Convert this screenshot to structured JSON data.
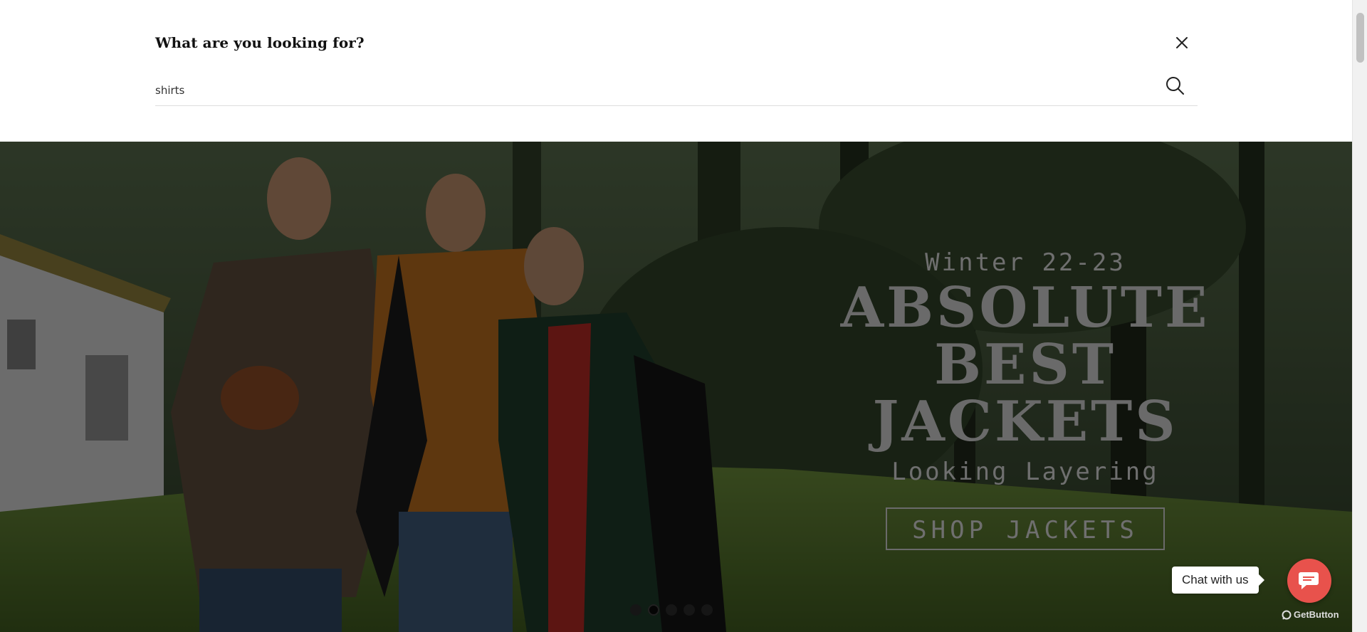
{
  "search": {
    "title": "What are you looking for?",
    "value": "shirts",
    "close_icon": "close-icon",
    "submit_icon": "search-icon"
  },
  "hero": {
    "season": "Winter 22-23",
    "headline_line1": "ABSOLUTE",
    "headline_line2": "BEST JACKETS",
    "subtitle": "Looking Layering",
    "cta_label": "SHOP JACKETS",
    "slides_count": 5,
    "active_slide": 2
  },
  "chat": {
    "bubble_text": "Chat with us",
    "icon": "chat-icon",
    "brand_label": "GetButton",
    "brand_color": "#e8524c"
  }
}
